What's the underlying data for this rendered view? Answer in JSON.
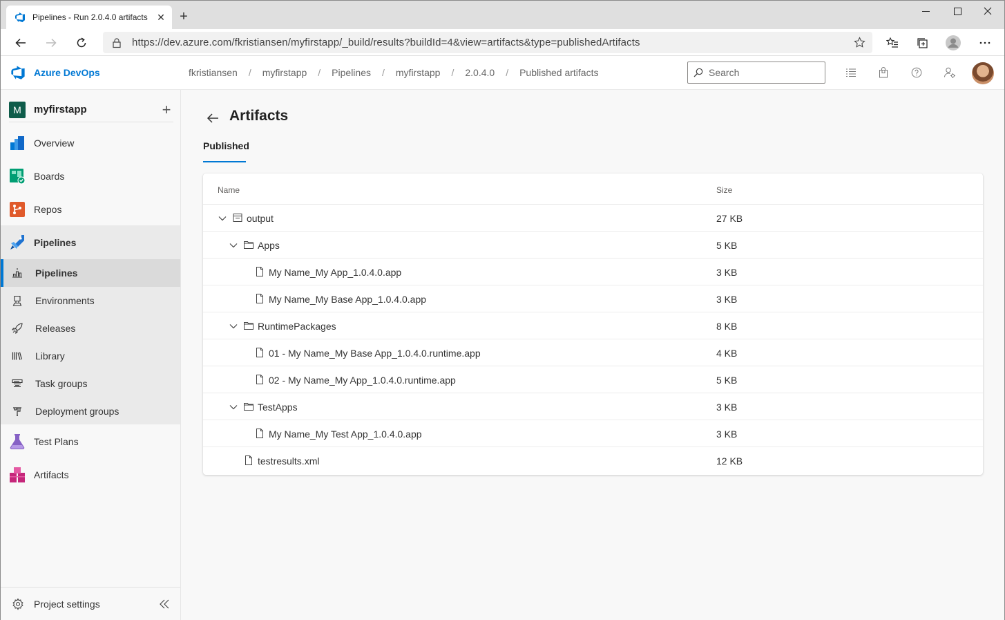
{
  "browser": {
    "tab_title": "Pipelines - Run 2.0.4.0 artifacts",
    "url": "https://dev.azure.com/fkristiansen/myfirstapp/_build/results?buildId=4&view=artifacts&type=publishedArtifacts"
  },
  "header": {
    "brand": "Azure DevOps",
    "breadcrumbs": [
      "fkristiansen",
      "myfirstapp",
      "Pipelines",
      "myfirstapp",
      "2.0.4.0",
      "Published artifacts"
    ],
    "breadcrumb_separator": "/",
    "search_placeholder": "Search"
  },
  "sidebar": {
    "project_initial": "M",
    "project_name": "myfirstapp",
    "items": [
      {
        "label": "Overview",
        "icon": "overview-icon"
      },
      {
        "label": "Boards",
        "icon": "boards-icon"
      },
      {
        "label": "Repos",
        "icon": "repos-icon"
      },
      {
        "label": "Pipelines",
        "icon": "pipelines-icon"
      },
      {
        "label": "Pipelines",
        "icon": "pipelines-sub-icon"
      },
      {
        "label": "Environments",
        "icon": "environments-icon"
      },
      {
        "label": "Releases",
        "icon": "releases-icon"
      },
      {
        "label": "Library",
        "icon": "library-icon"
      },
      {
        "label": "Task groups",
        "icon": "task-groups-icon"
      },
      {
        "label": "Deployment groups",
        "icon": "deployment-groups-icon"
      },
      {
        "label": "Test Plans",
        "icon": "test-plans-icon"
      },
      {
        "label": "Artifacts",
        "icon": "artifacts-icon"
      }
    ],
    "settings_label": "Project settings"
  },
  "main": {
    "title": "Artifacts",
    "tab": "Published",
    "columns": {
      "name": "Name",
      "size": "Size"
    },
    "rows": [
      {
        "name": "output",
        "size": "27 KB",
        "type": "artifact",
        "level": 0,
        "expanded": true
      },
      {
        "name": "Apps",
        "size": "5 KB",
        "type": "folder",
        "level": 1,
        "expanded": true
      },
      {
        "name": "My Name_My App_1.0.4.0.app",
        "size": "3 KB",
        "type": "file",
        "level": 2
      },
      {
        "name": "My Name_My Base App_1.0.4.0.app",
        "size": "3 KB",
        "type": "file",
        "level": 2
      },
      {
        "name": "RuntimePackages",
        "size": "8 KB",
        "type": "folder",
        "level": 1,
        "expanded": true
      },
      {
        "name": "01 - My Name_My Base App_1.0.4.0.runtime.app",
        "size": "4 KB",
        "type": "file",
        "level": 2
      },
      {
        "name": "02 - My Name_My App_1.0.4.0.runtime.app",
        "size": "5 KB",
        "type": "file",
        "level": 2
      },
      {
        "name": "TestApps",
        "size": "3 KB",
        "type": "folder",
        "level": 1,
        "expanded": true
      },
      {
        "name": "My Name_My Test App_1.0.4.0.app",
        "size": "3 KB",
        "type": "file",
        "level": 2
      },
      {
        "name": "testresults.xml",
        "size": "12 KB",
        "type": "file",
        "level": 1
      }
    ]
  },
  "colors": {
    "accent": "#0078d4",
    "project_badge": "#0e5c4a"
  }
}
